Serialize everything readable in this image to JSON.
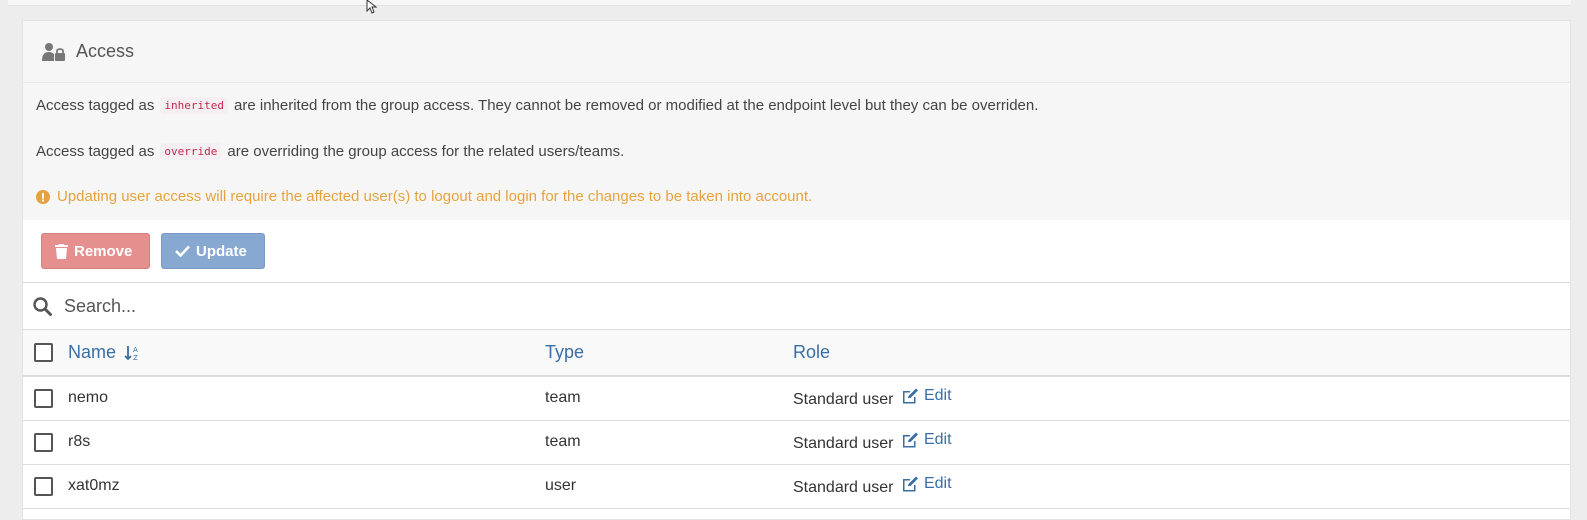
{
  "header": {
    "title": "Access",
    "icon": "user-lock-icon"
  },
  "info": {
    "line1": {
      "before": "Access tagged as",
      "tag": "inherited",
      "after": "are inherited from the group access. They cannot be removed or modified at the endpoint level but they can be overriden."
    },
    "line2": {
      "before": "Access tagged as",
      "tag": "override",
      "after": "are overriding the group access for the related users/teams."
    },
    "warning": "Updating user access will require the affected user(s) to logout and login for the changes to be taken into account."
  },
  "actions": {
    "remove_label": "Remove",
    "update_label": "Update"
  },
  "search": {
    "placeholder": "Search..."
  },
  "table": {
    "headers": {
      "name": "Name",
      "type": "Type",
      "role": "Role"
    },
    "rows": [
      {
        "name": "nemo",
        "type": "team",
        "role": "Standard user",
        "edit": "Edit"
      },
      {
        "name": "r8s",
        "type": "team",
        "role": "Standard user",
        "edit": "Edit"
      },
      {
        "name": "xat0mz",
        "type": "user",
        "role": "Standard user",
        "edit": "Edit"
      }
    ]
  },
  "colors": {
    "link": "#3a6ea5",
    "warning": "#e8a23d",
    "remove_button": "#e5908e",
    "update_button": "#87a9d1"
  }
}
